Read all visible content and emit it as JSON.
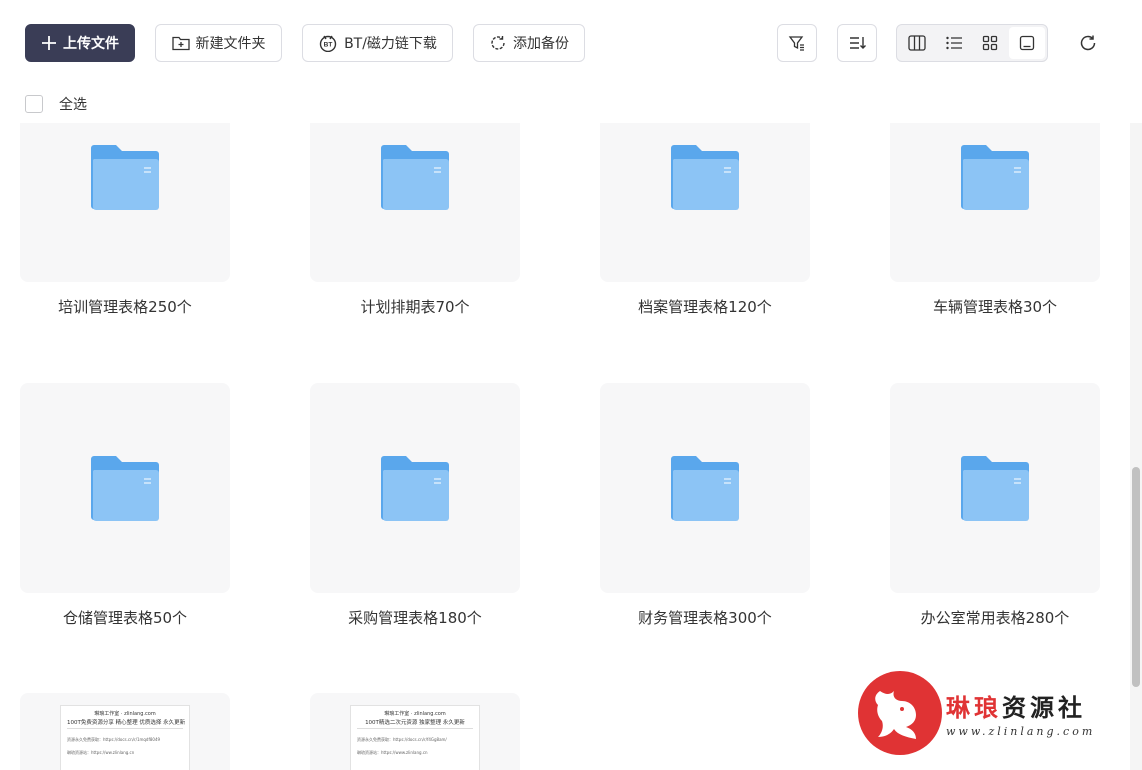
{
  "toolbar": {
    "upload_label": "上传文件",
    "newfolder_label": "新建文件夹",
    "bt_label": "BT/磁力链下载",
    "backup_label": "添加备份"
  },
  "select_all_label": "全选",
  "folders": [
    {
      "name": "培训管理表格250个"
    },
    {
      "name": "计划排期表70个"
    },
    {
      "name": "档案管理表格120个"
    },
    {
      "name": "车辆管理表格30个"
    },
    {
      "name": "仓储管理表格50个"
    },
    {
      "name": "采购管理表格180个"
    },
    {
      "name": "财务管理表格300个"
    },
    {
      "name": "办公室常用表格280个"
    }
  ],
  "docs": [
    {
      "line1": "琳琅工作室 · zlinlang.com",
      "line2": "100T免费资源分享 精心整理 优质选择 永久更新",
      "line3": "资源永久免费获取：https://docs.cn/r/1mqdf8049",
      "line4": "琳琅资源站：https://ww.zlinlang.cn"
    },
    {
      "line1": "琳琅工作室 · zlinlang.com",
      "line2": "100T精选二次元资源 独家整理 永久更新",
      "line3": "资源永久免费获取：https://docs.cn/r/f4Gg8am/",
      "line4": "琳琅资源站：https://www.zlinlang.cn"
    }
  ],
  "watermark": {
    "brand_first": "琳琅",
    "brand_rest": "资源社",
    "url": "www.zlinlang.com"
  },
  "colors": {
    "upload_bg": "#3a3d56",
    "folder_blue": "#8cc4f5",
    "folder_back": "#5aa7ec",
    "watermark_red": "#e03334"
  }
}
